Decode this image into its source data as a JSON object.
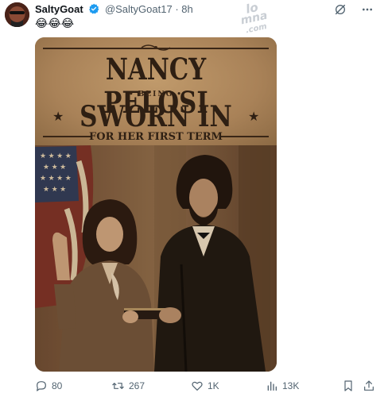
{
  "tweet": {
    "display_name": "SaltyGoat",
    "handle": "@SaltyGoat17",
    "separator": "·",
    "time": "8h",
    "text": "😂😂😂"
  },
  "watermark": {
    "line1": "lo",
    "line2": "mna",
    "line3": ".com"
  },
  "poster": {
    "headline1": "NANCY PELOSI",
    "connector": "BEING",
    "headline2": "SWORN IN",
    "headline3": "FOR HER FIRST TERM"
  },
  "actions": {
    "replies": "80",
    "reposts": "267",
    "likes": "1K",
    "views": "13K"
  },
  "colors": {
    "accent": "#1d9bf0",
    "muted": "#536471",
    "poster_ink": "#2e1f13"
  }
}
